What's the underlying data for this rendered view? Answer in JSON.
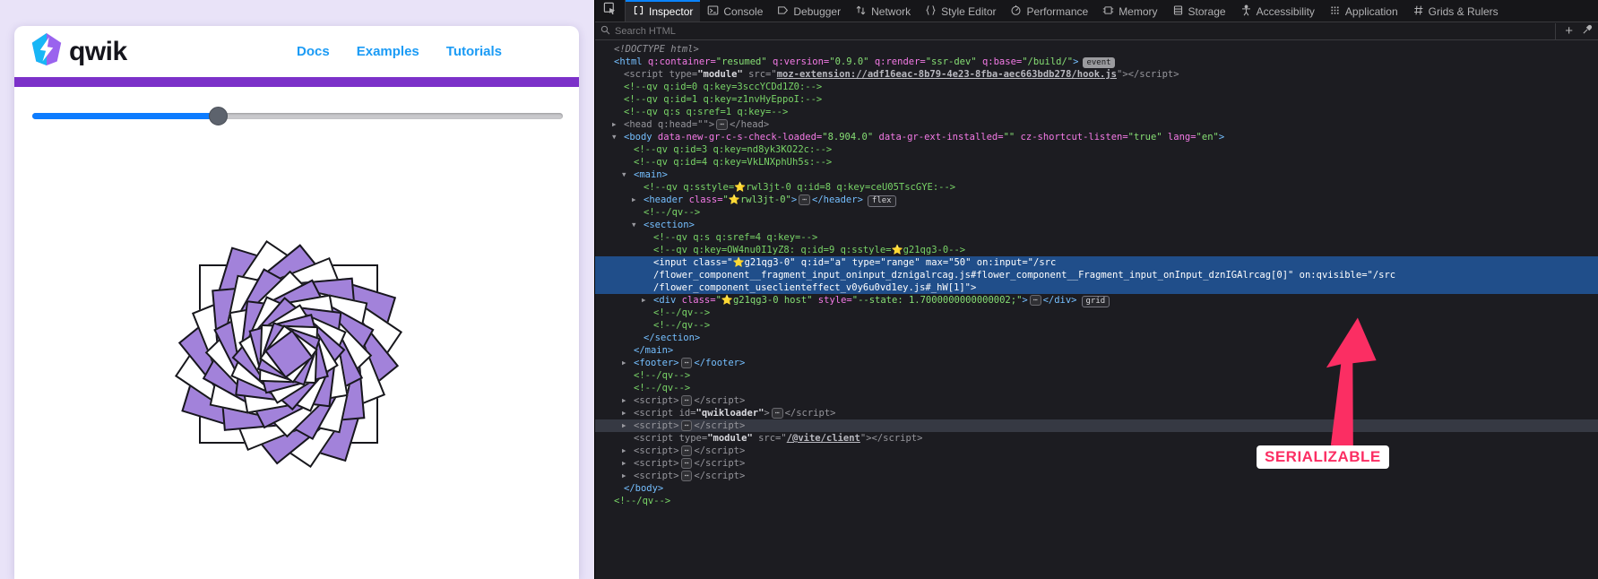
{
  "app": {
    "brand": "qwik",
    "nav_links": [
      "Docs",
      "Examples",
      "Tutorials"
    ],
    "nav_color": "#1b9bf5",
    "accent_bar_color": "#7c31c9",
    "slider": {
      "fill_percent": 35,
      "fill_color": "#0d7cff"
    },
    "flower": {
      "square_count": 20,
      "outer_size": 200,
      "size_step": 8.5,
      "rotation_step_deg": 17,
      "fill_white": "#ffffff",
      "fill_purple": "#a282da",
      "border_color": "#17171c",
      "state_value": "1.7000000000000002"
    }
  },
  "annotation": {
    "label": "SERIALIZABLE",
    "color": "#fb2e63"
  },
  "devtools": {
    "search_placeholder": "Search HTML",
    "selection_color": "#204e8a",
    "tabs": [
      {
        "label": "Inspector",
        "icon": "inspector-icon",
        "active": true
      },
      {
        "label": "Console",
        "icon": "console-icon",
        "active": false
      },
      {
        "label": "Debugger",
        "icon": "debugger-icon",
        "active": false
      },
      {
        "label": "Network",
        "icon": "network-icon",
        "active": false
      },
      {
        "label": "Style Editor",
        "icon": "style-editor-icon",
        "active": false
      },
      {
        "label": "Performance",
        "icon": "performance-icon",
        "active": false
      },
      {
        "label": "Memory",
        "icon": "memory-icon",
        "active": false
      },
      {
        "label": "Storage",
        "icon": "storage-icon",
        "active": false
      },
      {
        "label": "Accessibility",
        "icon": "accessibility-icon",
        "active": false
      },
      {
        "label": "Application",
        "icon": "application-icon",
        "active": false
      },
      {
        "label": "Grids & Rulers",
        "icon": "grids-rulers-icon",
        "active": false
      }
    ],
    "lines": [
      {
        "i": 0,
        "tw": null,
        "st": null,
        "s": [
          [
            "doc",
            "<!DOCTYPE html>"
          ]
        ]
      },
      {
        "i": 0,
        "tw": null,
        "st": null,
        "s": [
          [
            "tag",
            "<html"
          ],
          [
            "attr",
            " q:container="
          ],
          [
            "val",
            "\"resumed\""
          ],
          [
            "attr",
            " q:version="
          ],
          [
            "val",
            "\"0.9.0\""
          ],
          [
            "attr",
            " q:render="
          ],
          [
            "val",
            "\"ssr-dev\""
          ],
          [
            "attr",
            " q:base="
          ],
          [
            "val",
            "\"/build/\""
          ],
          [
            "tag",
            ">"
          ],
          [
            "badge",
            "event"
          ]
        ]
      },
      {
        "i": 1,
        "tw": null,
        "st": null,
        "s": [
          [
            "mut",
            "<script type="
          ],
          [
            "mutb",
            "\"module\""
          ],
          [
            "mut",
            " src=\""
          ],
          [
            "lnk",
            "moz-extension://adf16eac-8b79-4e23-8fba-aec663bdb278/hook.js"
          ],
          [
            "mut",
            "\"></script>"
          ]
        ]
      },
      {
        "i": 1,
        "tw": null,
        "st": null,
        "s": [
          [
            "com",
            "<!--qv q:id=0 q:key=3sccYCDd1Z0:-->"
          ]
        ]
      },
      {
        "i": 1,
        "tw": null,
        "st": null,
        "s": [
          [
            "com",
            "<!--qv q:id=1 q:key=z1nvHyEppoI:-->"
          ]
        ]
      },
      {
        "i": 1,
        "tw": null,
        "st": null,
        "s": [
          [
            "com",
            "<!--qv q:s q:sref=1 q:key=-->"
          ]
        ]
      },
      {
        "i": 1,
        "tw": "c",
        "st": null,
        "s": [
          [
            "mut",
            "<head q:head=\"\">"
          ],
          [
            "dots",
            "⋯"
          ],
          [
            "mut",
            "</head>"
          ]
        ]
      },
      {
        "i": 1,
        "tw": "o",
        "st": null,
        "s": [
          [
            "tag",
            "<body"
          ],
          [
            "attr",
            " data-new-gr-c-s-check-loaded="
          ],
          [
            "val",
            "\"8.904.0\""
          ],
          [
            "attr",
            " data-gr-ext-installed="
          ],
          [
            "val",
            "\"\""
          ],
          [
            "attr",
            " cz-shortcut-listen="
          ],
          [
            "val",
            "\"true\""
          ],
          [
            "attr",
            " lang="
          ],
          [
            "val",
            "\"en\""
          ],
          [
            "tag",
            ">"
          ]
        ]
      },
      {
        "i": 2,
        "tw": null,
        "st": null,
        "s": [
          [
            "com",
            "<!--qv q:id=3 q:key=nd8yk3KO22c:-->"
          ]
        ]
      },
      {
        "i": 2,
        "tw": null,
        "st": null,
        "s": [
          [
            "com",
            "<!--qv q:id=4 q:key=VkLNXphUh5s:-->"
          ]
        ]
      },
      {
        "i": 2,
        "tw": "o",
        "st": null,
        "s": [
          [
            "tag",
            "<main>"
          ]
        ]
      },
      {
        "i": 3,
        "tw": null,
        "st": null,
        "s": [
          [
            "com",
            "<!--qv q:sstyle="
          ],
          [
            "star",
            "⭐"
          ],
          [
            "com",
            "rwl3jt-0 q:id=8 q:key=ceU05TscGYE:-->"
          ]
        ]
      },
      {
        "i": 3,
        "tw": "c",
        "st": null,
        "s": [
          [
            "tag",
            "<header"
          ],
          [
            "attr",
            " class="
          ],
          [
            "val",
            "\""
          ],
          [
            "star",
            "⭐"
          ],
          [
            "val",
            "rwl3jt-0\""
          ],
          [
            "tag",
            ">"
          ],
          [
            "dots",
            "⋯"
          ],
          [
            "tag",
            "</header>"
          ],
          [
            "badgeo",
            "flex"
          ]
        ]
      },
      {
        "i": 3,
        "tw": null,
        "st": null,
        "s": [
          [
            "com",
            "<!--/qv-->"
          ]
        ]
      },
      {
        "i": 3,
        "tw": "o",
        "st": null,
        "s": [
          [
            "tag",
            "<section>"
          ]
        ]
      },
      {
        "i": 4,
        "tw": null,
        "st": null,
        "s": [
          [
            "com",
            "<!--qv q:s q:sref=4 q:key=-->"
          ]
        ]
      },
      {
        "i": 4,
        "tw": null,
        "st": null,
        "s": [
          [
            "com",
            "<!--qv q:key=OW4nu0I1yZ8: q:id=9 q:sstyle="
          ],
          [
            "star",
            "⭐"
          ],
          [
            "com",
            "g21qg3-0-->"
          ]
        ]
      },
      {
        "i": 4,
        "tw": null,
        "st": "sel",
        "s": [
          [
            "sel",
            "<input class=\""
          ],
          [
            "star",
            "⭐"
          ],
          [
            "sel",
            "g21qg3-0\" q:id=\"a\" type=\"range\" max=\"50\" on:input=\"/src"
          ]
        ]
      },
      {
        "i": 4,
        "tw": null,
        "st": "sel",
        "s": [
          [
            "sel",
            "/flower_component__fragment_input_oninput_dznigalrcag.js#flower_component__Fragment_input_onInput_dznIGAlrcag[0]\" on:qvisible=\"/src"
          ]
        ]
      },
      {
        "i": 4,
        "tw": null,
        "st": "sel",
        "s": [
          [
            "sel",
            "/flower_component_useclienteffect_v0y6u0vd1ey.js#_hW[1]\">"
          ]
        ]
      },
      {
        "i": 4,
        "tw": "c",
        "st": null,
        "s": [
          [
            "tag",
            "<div"
          ],
          [
            "attr",
            " class="
          ],
          [
            "val",
            "\""
          ],
          [
            "star",
            "⭐"
          ],
          [
            "val",
            "g21qg3-0 host\""
          ],
          [
            "attr",
            " style="
          ],
          [
            "val",
            "\"--state: 1.7000000000000002;\""
          ],
          [
            "tag",
            ">"
          ],
          [
            "dots",
            "⋯"
          ],
          [
            "tag",
            "</div>"
          ],
          [
            "badgeo",
            "grid"
          ]
        ]
      },
      {
        "i": 4,
        "tw": null,
        "st": null,
        "s": [
          [
            "com",
            "<!--/qv-->"
          ]
        ]
      },
      {
        "i": 4,
        "tw": null,
        "st": null,
        "s": [
          [
            "com",
            "<!--/qv-->"
          ]
        ]
      },
      {
        "i": 3,
        "tw": null,
        "st": null,
        "s": [
          [
            "tag",
            "</section>"
          ]
        ]
      },
      {
        "i": 2,
        "tw": null,
        "st": null,
        "s": [
          [
            "tag",
            "</main>"
          ]
        ]
      },
      {
        "i": 2,
        "tw": "c",
        "st": null,
        "s": [
          [
            "tag",
            "<footer>"
          ],
          [
            "dots",
            "⋯"
          ],
          [
            "tag",
            "</footer>"
          ]
        ]
      },
      {
        "i": 2,
        "tw": null,
        "st": null,
        "s": [
          [
            "com",
            "<!--/qv-->"
          ]
        ]
      },
      {
        "i": 2,
        "tw": null,
        "st": null,
        "s": [
          [
            "com",
            "<!--/qv-->"
          ]
        ]
      },
      {
        "i": 2,
        "tw": "c",
        "st": null,
        "s": [
          [
            "mut",
            "<script>"
          ],
          [
            "dots",
            "⋯"
          ],
          [
            "mut",
            "</script>"
          ]
        ]
      },
      {
        "i": 2,
        "tw": "c",
        "st": null,
        "s": [
          [
            "mut",
            "<script id="
          ],
          [
            "mutb",
            "\"qwikloader\""
          ],
          [
            "mut",
            ">"
          ],
          [
            "dots",
            "⋯"
          ],
          [
            "mut",
            "</script>"
          ]
        ]
      },
      {
        "i": 2,
        "tw": "c",
        "st": "hov",
        "s": [
          [
            "mut",
            "<script>"
          ],
          [
            "dots",
            "⋯"
          ],
          [
            "mut",
            "</script>"
          ]
        ]
      },
      {
        "i": 2,
        "tw": null,
        "st": null,
        "s": [
          [
            "mut",
            "<script type="
          ],
          [
            "mutb",
            "\"module\""
          ],
          [
            "mut",
            " src=\""
          ],
          [
            "lnk",
            "/@vite/client"
          ],
          [
            "mut",
            "\"></script>"
          ]
        ]
      },
      {
        "i": 2,
        "tw": "c",
        "st": null,
        "s": [
          [
            "mut",
            "<script>"
          ],
          [
            "dots",
            "⋯"
          ],
          [
            "mut",
            "</script>"
          ]
        ]
      },
      {
        "i": 2,
        "tw": "c",
        "st": null,
        "s": [
          [
            "mut",
            "<script>"
          ],
          [
            "dots",
            "⋯"
          ],
          [
            "mut",
            "</script>"
          ]
        ]
      },
      {
        "i": 2,
        "tw": "c",
        "st": null,
        "s": [
          [
            "mut",
            "<script>"
          ],
          [
            "dots",
            "⋯"
          ],
          [
            "mut",
            "</script>"
          ]
        ]
      },
      {
        "i": 1,
        "tw": null,
        "st": null,
        "s": [
          [
            "tag",
            "</body>"
          ]
        ]
      },
      {
        "i": 0,
        "tw": null,
        "st": null,
        "s": [
          [
            "com",
            "<!--/qv-->"
          ]
        ]
      }
    ]
  }
}
